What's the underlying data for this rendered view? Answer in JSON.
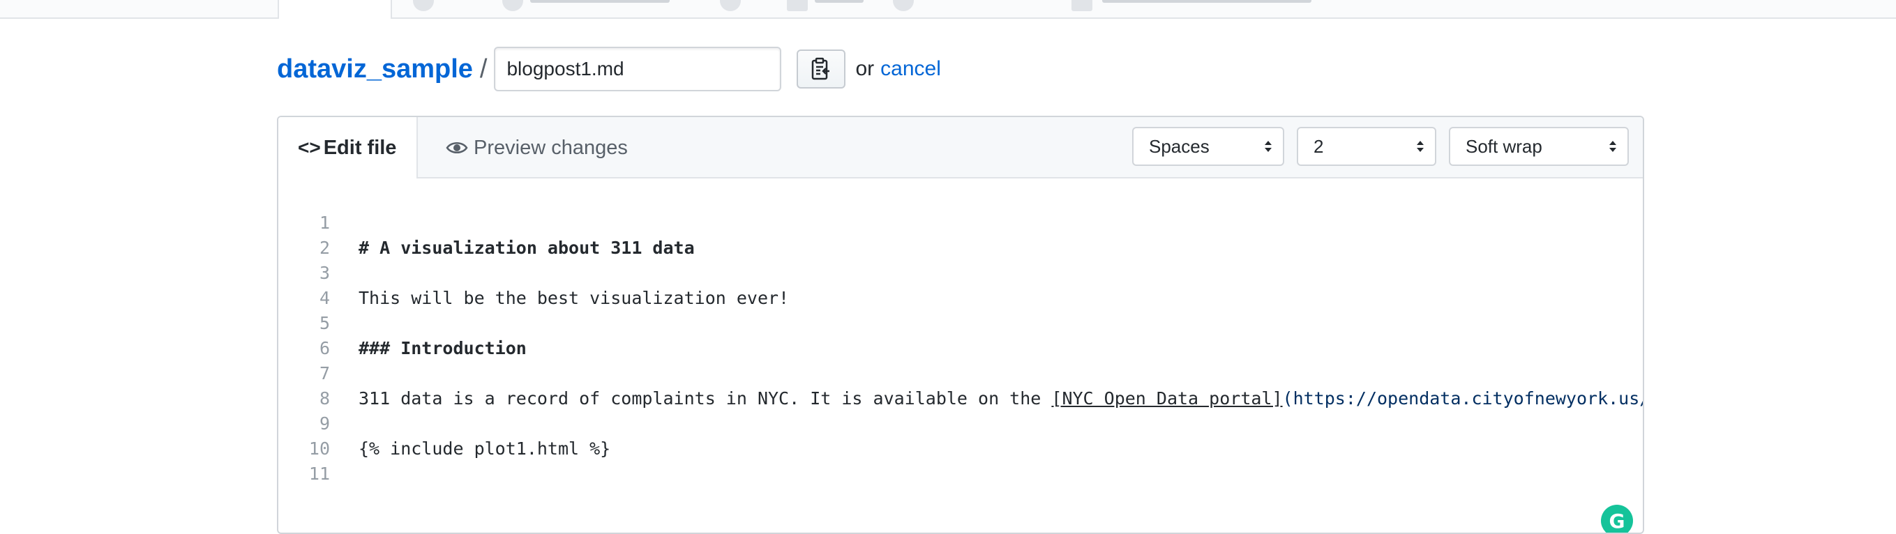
{
  "breadcrumb": {
    "repo": "dataviz_sample",
    "separator": "/",
    "filename": "blogpost1.md",
    "or_text": "or",
    "cancel": "cancel"
  },
  "editor": {
    "tabs": {
      "edit": "Edit file",
      "preview": "Preview changes"
    },
    "indent_mode": "Spaces",
    "indent_size": "2",
    "wrap_mode": "Soft wrap",
    "lines": [
      {
        "no": "1",
        "text": "# A visualization about 311 data"
      },
      {
        "no": "2",
        "text": ""
      },
      {
        "no": "3",
        "text": "This will be the best visualization ever!"
      },
      {
        "no": "4",
        "text": ""
      },
      {
        "no": "5",
        "text": "### Introduction"
      },
      {
        "no": "6",
        "text": ""
      },
      {
        "no": "7",
        "prefix": "311 data is a record of complaints in NYC. It is available on the ",
        "link_text": "[NYC Open Data portal]",
        "link_url": "(https://opendata.cityofnewyork.us/)"
      },
      {
        "no": "8",
        "text": ""
      },
      {
        "no": "9",
        "text": "{% include plot1.html %}"
      },
      {
        "no": "10",
        "text": ""
      },
      {
        "no": "11",
        "text": ""
      }
    ]
  },
  "icons": {
    "clipboard": "clipboard-icon",
    "code": "code-icon",
    "eye": "eye-icon",
    "select_arrows": "select-arrows-icon",
    "grammarly": "grammarly-icon"
  },
  "colors": {
    "link": "#0366d6",
    "grammarly": "#15c39a",
    "header_bg": "#f6f8fa",
    "border": "#d1d5da"
  }
}
